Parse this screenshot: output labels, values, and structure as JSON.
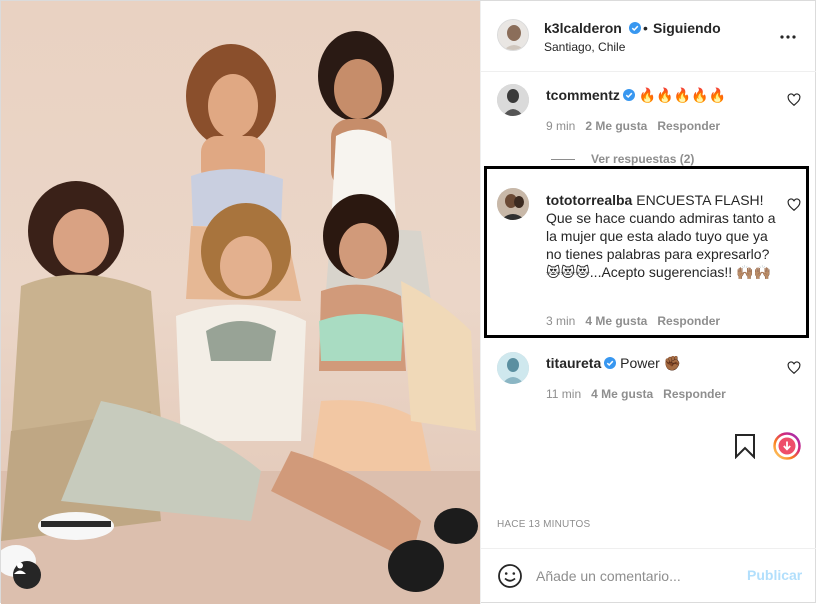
{
  "post_header": {
    "username": "k3lcalderon",
    "separator": "•",
    "follow_label": "Siguiendo",
    "location": "Santiago, Chile"
  },
  "comments": [
    {
      "username": "tcommentz",
      "text": "🔥🔥🔥🔥🔥",
      "time": "9 min",
      "likes": "2 Me gusta",
      "reply": "Responder",
      "verified": true
    },
    {
      "username": "tototorrealba",
      "text": "ENCUESTA FLASH! Que se hace cuando admiras tanto a la mujer que esta alado tuyo que ya no tienes palabras para expresarlo? 😻😻😻...Acepto sugerencias!! 🙌🏽🙌🏽",
      "time": "3 min",
      "likes": "4 Me gusta",
      "reply": "Responder",
      "verified": false
    },
    {
      "username": "titaureta",
      "text": "Power ✊🏾",
      "time": "11 min",
      "likes": "4 Me gusta",
      "reply": "Responder",
      "verified": true
    }
  ],
  "view_replies": "Ver respuestas (2)",
  "timestamp": "HACE 13 MINUTOS",
  "add_comment": {
    "placeholder": "Añade un comentario...",
    "publish_label": "Publicar"
  },
  "colors": {
    "verified_blue": "#3897f0",
    "publish_disabled": "#b2dffc",
    "meta_gray": "#8e8e8e"
  },
  "icons": [
    "more-options-icon",
    "heart-icon",
    "bookmark-icon",
    "story-ring-icon",
    "emoji-icon",
    "user-tag-icon",
    "verified-badge-icon"
  ]
}
